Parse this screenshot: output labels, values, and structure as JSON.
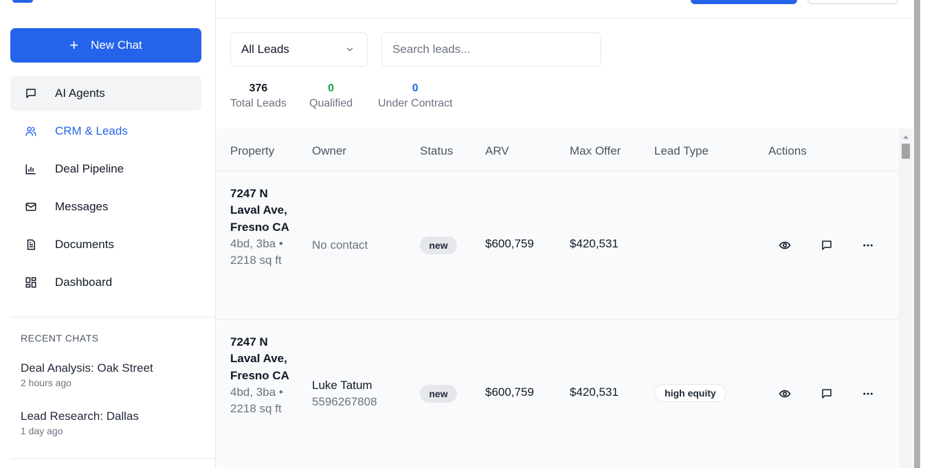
{
  "sidebar": {
    "new_chat_label": "New Chat",
    "nav": [
      {
        "label": "AI Agents",
        "icon": "chat-bubble-icon"
      },
      {
        "label": "CRM & Leads",
        "icon": "users-icon"
      },
      {
        "label": "Deal Pipeline",
        "icon": "bar-chart-icon"
      },
      {
        "label": "Messages",
        "icon": "mail-icon"
      },
      {
        "label": "Documents",
        "icon": "document-icon"
      },
      {
        "label": "Dashboard",
        "icon": "dashboard-grid-icon"
      }
    ],
    "recent_title": "RECENT CHATS",
    "recent": [
      {
        "title": "Deal Analysis: Oak Street",
        "time": "2 hours ago"
      },
      {
        "title": "Lead Research: Dallas",
        "time": "1 day ago"
      }
    ]
  },
  "filters": {
    "lead_filter": "All Leads",
    "search_placeholder": "Search leads..."
  },
  "stats": [
    {
      "value": "376",
      "label": "Total Leads",
      "color": "#111827"
    },
    {
      "value": "0",
      "label": "Qualified",
      "color": "#16a34a"
    },
    {
      "value": "0",
      "label": "Under Contract",
      "color": "#2563eb"
    }
  ],
  "table": {
    "headers": [
      "Property",
      "Owner",
      "Status",
      "ARV",
      "Max Offer",
      "Lead Type",
      "Actions"
    ],
    "rows": [
      {
        "address": "7247 N Laval Ave, Fresno CA",
        "details": "4bd, 3ba • 2218 sq ft",
        "owner_name": "",
        "owner_phone": "",
        "no_contact": "No contact",
        "status": "new",
        "arv": "$600,759",
        "max_offer": "$420,531",
        "lead_type": ""
      },
      {
        "address": "7247 N Laval Ave, Fresno CA",
        "details": "4bd, 3ba • 2218 sq ft",
        "owner_name": "Luke Tatum",
        "owner_phone": "5596267808",
        "no_contact": "",
        "status": "new",
        "arv": "$600,759",
        "max_offer": "$420,531",
        "lead_type": "high equity"
      }
    ]
  },
  "colors": {
    "accent": "#2563eb",
    "qualified": "#16a34a"
  }
}
